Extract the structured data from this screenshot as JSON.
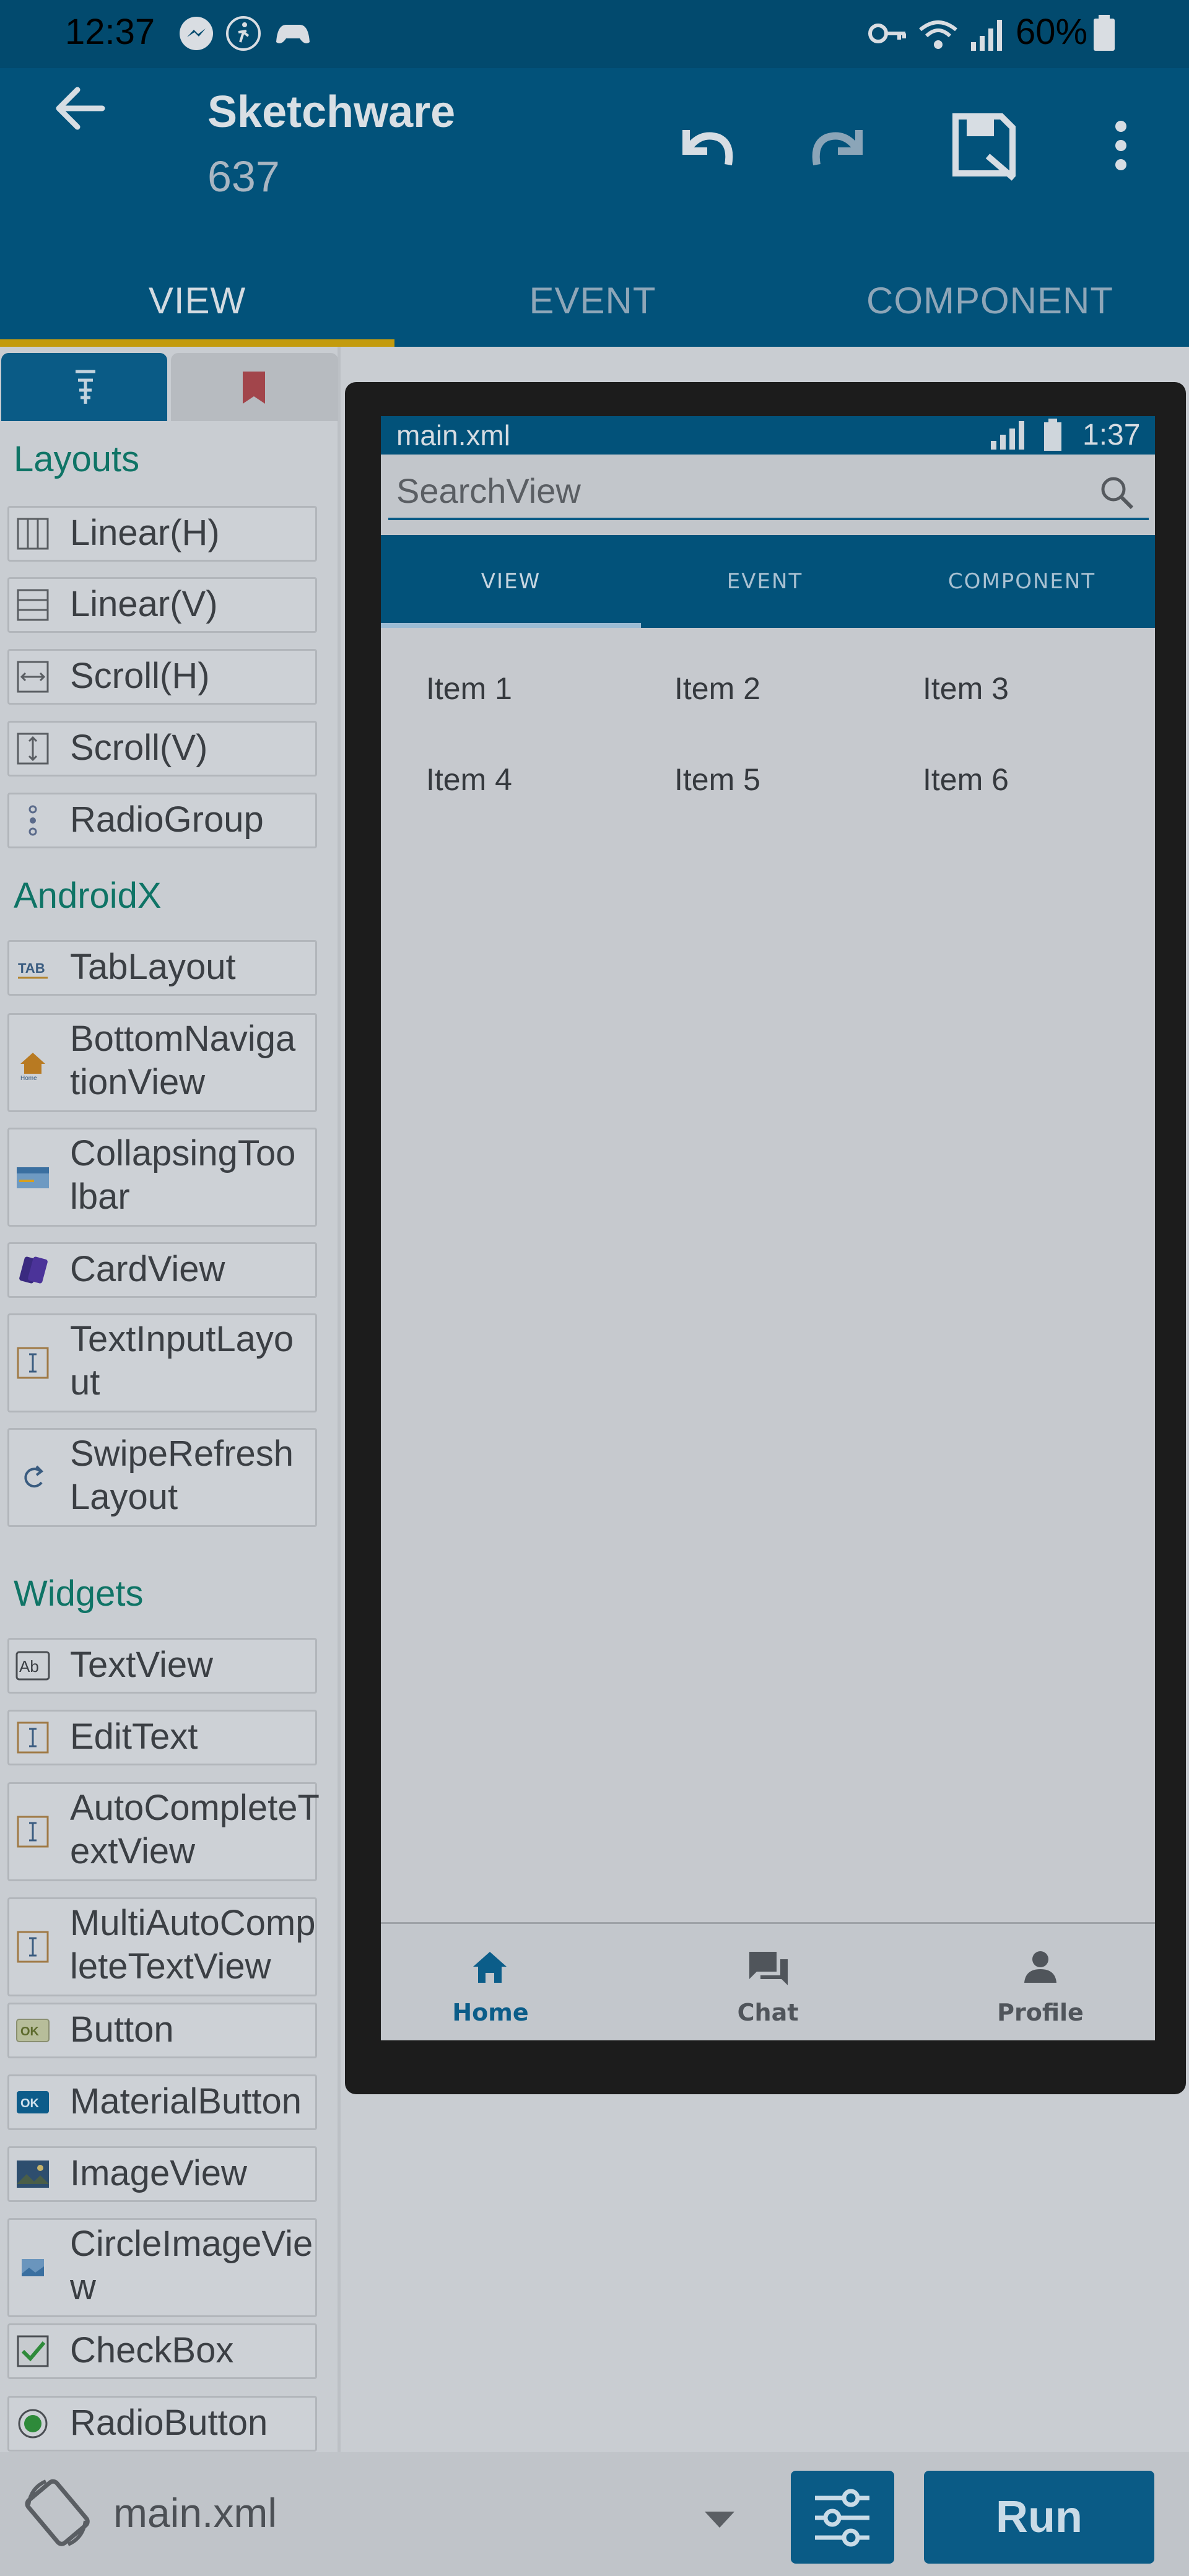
{
  "status_bar": {
    "time": "12:37",
    "battery": "60%"
  },
  "app_bar": {
    "title": "Sketchware",
    "subtitle": "637"
  },
  "tabs": [
    {
      "label": "VIEW",
      "active": true
    },
    {
      "label": "EVENT",
      "active": false
    },
    {
      "label": "COMPONENT",
      "active": false
    }
  ],
  "palette": {
    "layouts_header": "Layouts",
    "layouts": [
      "Linear(H)",
      "Linear(V)",
      "Scroll(H)",
      "Scroll(V)",
      "RadioGroup"
    ],
    "androidx_header": "AndroidX",
    "androidx": [
      "TabLayout",
      "BottomNaviga tionView",
      "CollapsingToo lbar",
      "CardView",
      "TextInputLayo ut",
      "SwipeRefresh Layout"
    ],
    "widgets_header": "Widgets",
    "widgets": [
      "TextView",
      "EditText",
      "AutoCompleteT extView",
      "MultiAutoComp leteTextView",
      "Button",
      "MaterialButton",
      "ImageView",
      "CircleImageVie w",
      "CheckBox",
      "RadioButton"
    ],
    "icon_names": {
      "layouts": [
        "linear-h-icon",
        "linear-v-icon",
        "scroll-h-icon",
        "scroll-v-icon",
        "radiogroup-icon"
      ],
      "androidx": [
        "tablayout-icon",
        "home-icon",
        "toolbar-icon",
        "cardview-icon",
        "text-input-icon",
        "refresh-icon"
      ],
      "widgets": [
        "textview-icon",
        "edittext-icon",
        "autocomplete-icon",
        "multiautocomplete-icon",
        "button-icon",
        "materialbutton-icon",
        "imageview-icon",
        "circleimage-icon",
        "checkbox-icon",
        "radiobutton-icon"
      ]
    }
  },
  "preview": {
    "file": "main.xml",
    "time": "1:37",
    "search_placeholder": "SearchView",
    "tabs": [
      "VIEW",
      "EVENT",
      "COMPONENT"
    ],
    "grid": [
      "Item 1",
      "Item 2",
      "Item 3",
      "Item 4",
      "Item 5",
      "Item 6"
    ],
    "bottom_nav": [
      "Home",
      "Chat",
      "Profile"
    ]
  },
  "bottom_bar": {
    "file": "main.xml",
    "run_label": "Run"
  },
  "colors": {
    "primary": "#02527a",
    "accent": "#0a5b86",
    "indicator": "#c39b0e",
    "section": "#0f7466"
  }
}
